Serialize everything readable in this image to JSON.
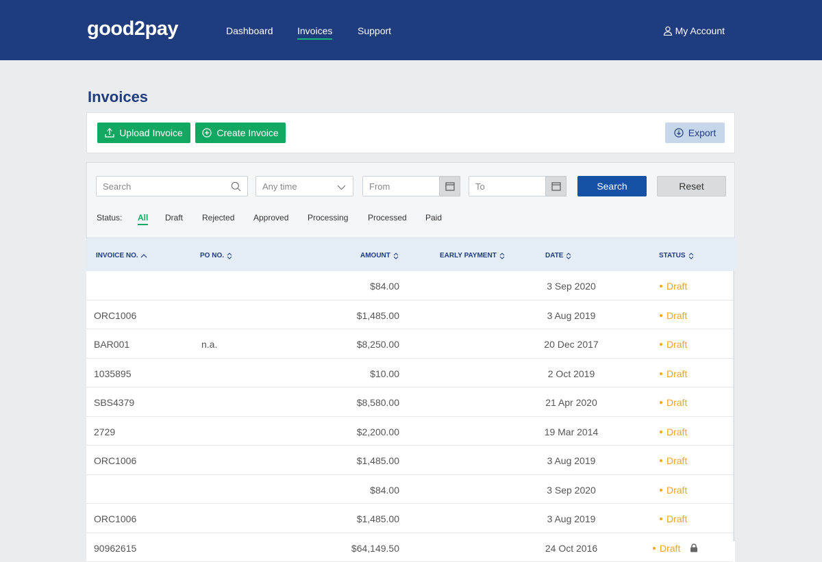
{
  "header": {
    "logo": "good2pay",
    "nav": [
      {
        "label": "Dashboard"
      },
      {
        "label": "Invoices",
        "active": true
      },
      {
        "label": "Support"
      }
    ],
    "account_label": "My Account",
    "account_icon": "user-icon"
  },
  "page": {
    "title": "Invoices"
  },
  "actions": {
    "upload_label": "Upload Invoice",
    "create_label": "Create Invoice",
    "export_label": "Export"
  },
  "filters": {
    "search_placeholder": "Search",
    "time_value": "Any time",
    "from_placeholder": "From",
    "to_placeholder": "To",
    "search_button": "Search",
    "reset_button": "Reset",
    "status_label": "Status:",
    "status_tabs": [
      "All",
      "Draft",
      "Rejected",
      "Approved",
      "Processing",
      "Processed",
      "Paid"
    ],
    "active_status": "All"
  },
  "table": {
    "columns": [
      "INVOICE NO.",
      "PO NO.",
      "AMOUNT",
      "EARLY PAYMENT",
      "DATE",
      "STATUS"
    ],
    "rows": [
      {
        "invoice": "",
        "po": "",
        "amount": "$84.00",
        "early": "",
        "date": "3 Sep 2020",
        "status": "Draft"
      },
      {
        "invoice": "ORC1006",
        "po": "",
        "amount": "$1,485.00",
        "early": "",
        "date": "3 Aug 2019",
        "status": "Draft"
      },
      {
        "invoice": "BAR001",
        "po": "n.a.",
        "amount": "$8,250.00",
        "early": "",
        "date": "20 Dec 2017",
        "status": "Draft"
      },
      {
        "invoice": "1035895",
        "po": "",
        "amount": "$10.00",
        "early": "",
        "date": "2 Oct 2019",
        "status": "Draft"
      },
      {
        "invoice": "SBS4379",
        "po": "",
        "amount": "$8,580.00",
        "early": "",
        "date": "21 Apr 2020",
        "status": "Draft"
      },
      {
        "invoice": "2729",
        "po": "",
        "amount": "$2,200.00",
        "early": "",
        "date": "19 Mar 2014",
        "status": "Draft"
      },
      {
        "invoice": "ORC1006",
        "po": "",
        "amount": "$1,485.00",
        "early": "",
        "date": "3 Aug 2019",
        "status": "Draft"
      },
      {
        "invoice": "",
        "po": "",
        "amount": "$84.00",
        "early": "",
        "date": "3 Sep 2020",
        "status": "Draft"
      },
      {
        "invoice": "ORC1006",
        "po": "",
        "amount": "$1,485.00",
        "early": "",
        "date": "3 Aug 2019",
        "status": "Draft"
      },
      {
        "invoice": "90962615",
        "po": "",
        "amount": "$64,149.50",
        "early": "",
        "date": "24 Oct 2016",
        "status": "Draft",
        "locked": true
      }
    ]
  },
  "colors": {
    "header_bg": "#1f3c7f",
    "accent_green": "#13a862",
    "draft_orange": "#f2a51a",
    "search_blue": "#1552a5"
  }
}
